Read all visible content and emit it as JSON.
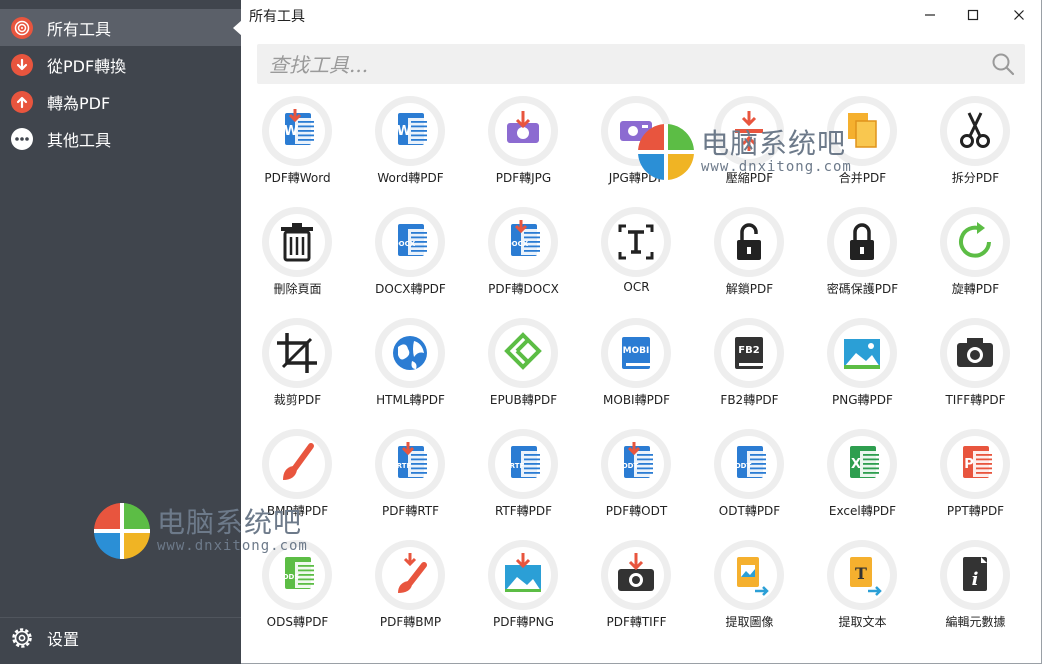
{
  "sidebar": {
    "items": [
      {
        "label": "所有工具",
        "icon": "all-tools-icon",
        "active": true
      },
      {
        "label": "從PDF轉換",
        "icon": "convert-from-pdf-icon"
      },
      {
        "label": "轉為PDF",
        "icon": "convert-to-pdf-icon"
      },
      {
        "label": "其他工具",
        "icon": "more-tools-icon"
      }
    ],
    "settings_label": "设置"
  },
  "window": {
    "title": "所有工具"
  },
  "search": {
    "placeholder": "查找工具..."
  },
  "tools": [
    {
      "label": "PDF轉Word",
      "icon": "pdf-to-word-icon"
    },
    {
      "label": "Word轉PDF",
      "icon": "word-to-pdf-icon"
    },
    {
      "label": "PDF轉JPG",
      "icon": "pdf-to-jpg-icon"
    },
    {
      "label": "JPG轉PDF",
      "icon": "jpg-to-pdf-icon"
    },
    {
      "label": "壓縮PDF",
      "icon": "compress-pdf-icon"
    },
    {
      "label": "合并PDF",
      "icon": "merge-pdf-icon"
    },
    {
      "label": "拆分PDF",
      "icon": "scissors-icon"
    },
    {
      "label": "刪除頁面",
      "icon": "trash-icon"
    },
    {
      "label": "DOCX轉PDF",
      "icon": "docx-to-pdf-icon"
    },
    {
      "label": "PDF轉DOCX",
      "icon": "pdf-to-docx-icon"
    },
    {
      "label": "OCR",
      "icon": "ocr-icon"
    },
    {
      "label": "解鎖PDF",
      "icon": "unlock-icon"
    },
    {
      "label": "密碼保護PDF",
      "icon": "lock-icon"
    },
    {
      "label": "旋轉PDF",
      "icon": "rotate-icon"
    },
    {
      "label": "裁剪PDF",
      "icon": "crop-icon"
    },
    {
      "label": "HTML轉PDF",
      "icon": "globe-icon"
    },
    {
      "label": "EPUB轉PDF",
      "icon": "epub-icon"
    },
    {
      "label": "MOBI轉PDF",
      "icon": "mobi-icon"
    },
    {
      "label": "FB2轉PDF",
      "icon": "fb2-icon"
    },
    {
      "label": "PNG轉PDF",
      "icon": "png-image-icon"
    },
    {
      "label": "TIFF轉PDF",
      "icon": "camera-icon"
    },
    {
      "label": "BMP轉PDF",
      "icon": "paint-brush-icon"
    },
    {
      "label": "PDF轉RTF",
      "icon": "pdf-to-rtf-icon"
    },
    {
      "label": "RTF轉PDF",
      "icon": "rtf-to-pdf-icon"
    },
    {
      "label": "PDF轉ODT",
      "icon": "pdf-to-odt-icon"
    },
    {
      "label": "ODT轉PDF",
      "icon": "odt-to-pdf-icon"
    },
    {
      "label": "Excel轉PDF",
      "icon": "excel-icon"
    },
    {
      "label": "PPT轉PDF",
      "icon": "powerpoint-icon"
    },
    {
      "label": "ODS轉PDF",
      "icon": "ods-icon"
    },
    {
      "label": "PDF轉BMP",
      "icon": "pdf-to-bmp-icon"
    },
    {
      "label": "PDF轉PNG",
      "icon": "pdf-to-png-icon"
    },
    {
      "label": "PDF轉TIFF",
      "icon": "pdf-to-tiff-icon"
    },
    {
      "label": "提取圖像",
      "icon": "extract-image-icon"
    },
    {
      "label": "提取文本",
      "icon": "extract-text-icon"
    },
    {
      "label": "編輯元數據",
      "icon": "metadata-info-icon"
    }
  ],
  "watermark": {
    "text": "电脑系统吧",
    "url": "www.dnxitong.com"
  },
  "colors": {
    "sidebar_bg": "#40454d",
    "sidebar_active": "#5b6069",
    "accent_red": "#e8553e",
    "word_blue": "#2b7cd3",
    "green": "#5cbd45"
  }
}
